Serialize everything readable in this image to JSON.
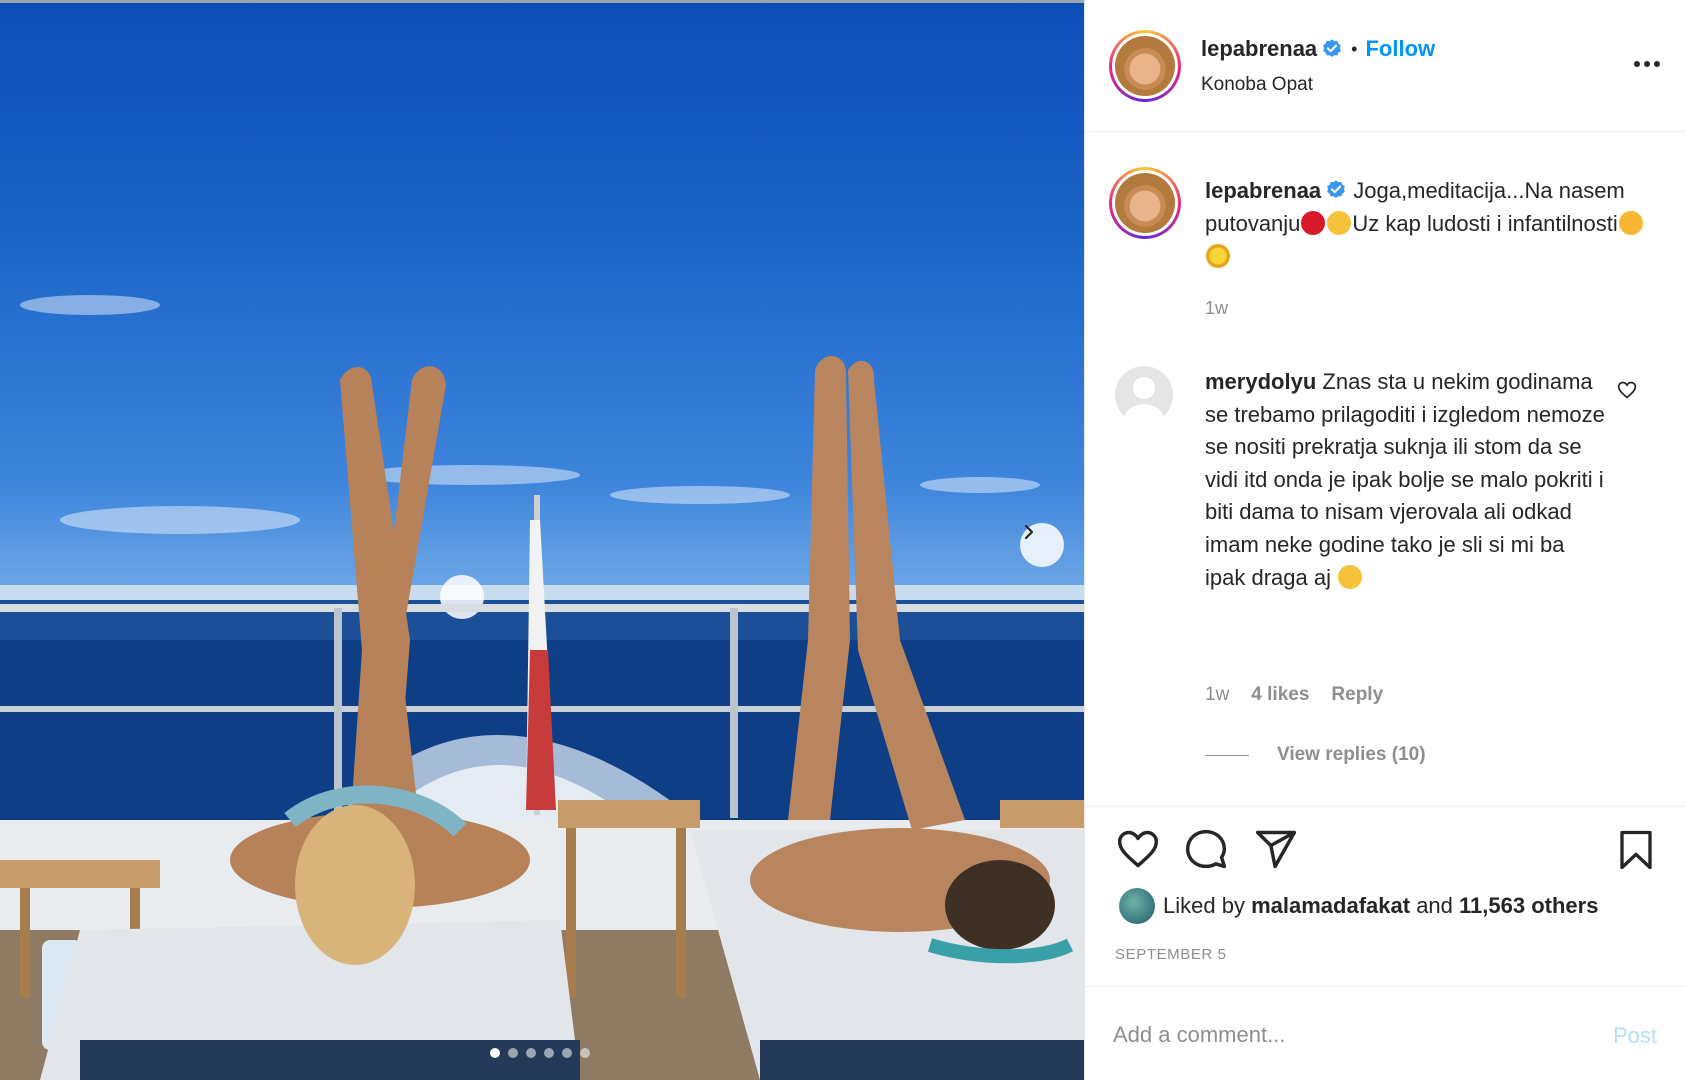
{
  "post": {
    "username": "lepabrenaa",
    "follow_label": "Follow",
    "separator": "•",
    "location": "Konoba Opat",
    "more_icon": "more-horizontal-icon"
  },
  "caption": {
    "username": "lepabrenaa",
    "text_part1": "Joga,meditacija...Na nasem putovanju",
    "text_part2": "Uz kap ludosti i infantilnosti",
    "time": "1w"
  },
  "comment": {
    "username": "merydolyu",
    "text": "Znas sta u nekim godinama se trebamo prilagoditi i izgledom nemoze se nositi prekratja suknja ili stom da se vidi itd onda je ipak bolje se malo pokriti i biti dama to nisam vjerovala ali odkad imam neke godine tako je sli si mi ba ipak draga aj",
    "time": "1w",
    "likes": "4 likes",
    "reply_label": "Reply",
    "view_replies": "View replies (10)"
  },
  "likes": {
    "prefix": "Liked by",
    "user": "malamadafakat",
    "middle": "and",
    "others": "11,563 others"
  },
  "date": "SEPTEMBER 5",
  "add_comment": {
    "placeholder": "Add a comment...",
    "post_label": "Post"
  },
  "carousel": {
    "total_slides": 6,
    "active_slide": 1
  },
  "colors": {
    "accent": "#0095f6",
    "post_disabled": "#b2dffc",
    "muted": "#8e8e8e"
  }
}
